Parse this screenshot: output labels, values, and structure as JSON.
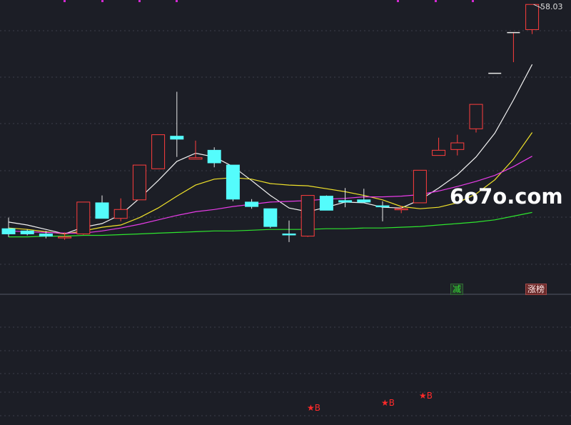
{
  "chart_data": {
    "type": "candlestick",
    "price_range": [
      20.0,
      58.6
    ],
    "max_price_label": "58.03",
    "candles": [
      {
        "o": 27.7,
        "c": 27.0,
        "h": 29.2,
        "l": 26.6
      },
      {
        "o": 27.4,
        "c": 27.0,
        "h": 27.6,
        "l": 26.8
      },
      {
        "o": 27.0,
        "c": 26.7,
        "h": 27.4,
        "l": 26.4
      },
      {
        "o": 26.5,
        "c": 26.6,
        "h": 27.2,
        "l": 26.2
      },
      {
        "o": 27.0,
        "c": 31.3,
        "h": 31.3,
        "l": 26.9
      },
      {
        "o": 31.2,
        "c": 29.1,
        "h": 32.2,
        "l": 29.1
      },
      {
        "o": 29.1,
        "c": 30.3,
        "h": 31.8,
        "l": 28.7
      },
      {
        "o": 31.6,
        "c": 36.3,
        "h": 36.3,
        "l": 31.6
      },
      {
        "o": 35.8,
        "c": 40.4,
        "h": 40.4,
        "l": 35.8
      },
      {
        "o": 40.2,
        "c": 39.8,
        "h": 46.2,
        "l": 37.4
      },
      {
        "o": 37.1,
        "c": 37.3,
        "h": 39.6,
        "l": 37.1
      },
      {
        "o": 38.3,
        "c": 36.6,
        "h": 38.7,
        "l": 36.0
      },
      {
        "o": 36.3,
        "c": 31.7,
        "h": 36.3,
        "l": 31.4
      },
      {
        "o": 31.3,
        "c": 30.7,
        "h": 31.7,
        "l": 30.4
      },
      {
        "o": 30.4,
        "c": 28.0,
        "h": 30.4,
        "l": 27.8
      },
      {
        "o": 27.0,
        "c": 26.9,
        "h": 28.8,
        "l": 25.9
      },
      {
        "o": 26.7,
        "c": 32.2,
        "h": 32.2,
        "l": 26.6
      },
      {
        "o": 32.1,
        "c": 30.2,
        "h": 32.2,
        "l": 30.2
      },
      {
        "o": 31.5,
        "c": 31.3,
        "h": 33.2,
        "l": 30.6
      },
      {
        "o": 31.6,
        "c": 31.3,
        "h": 33.1,
        "l": 31.2
      },
      {
        "o": 30.8,
        "c": 30.7,
        "h": 31.4,
        "l": 28.7
      },
      {
        "o": 30.3,
        "c": 30.4,
        "h": 30.8,
        "l": 29.8
      },
      {
        "o": 31.2,
        "c": 35.6,
        "h": 35.6,
        "l": 31.2
      },
      {
        "o": 37.6,
        "c": 38.3,
        "h": 40.0,
        "l": 37.6
      },
      {
        "o": 38.4,
        "c": 39.3,
        "h": 40.4,
        "l": 37.6
      },
      {
        "o": 41.2,
        "c": 44.5,
        "h": 44.5,
        "l": 40.7
      },
      {
        "o": 48.7,
        "c": 48.7,
        "h": 48.7,
        "l": 48.7
      },
      {
        "o": 54.2,
        "c": 54.2,
        "h": 54.2,
        "l": 50.2
      },
      {
        "o": 54.6,
        "c": 58.0,
        "h": 58.0,
        "l": 54.0
      }
    ],
    "moving_averages": [
      {
        "color": "#f2f2f2",
        "values": [
          28.6,
          28.2,
          27.6,
          27.0,
          27.9,
          28.4,
          29.6,
          31.8,
          34.2,
          36.8,
          37.9,
          37.4,
          36.1,
          34.2,
          32.2,
          30.5,
          30.0,
          30.6,
          31.3,
          31.2,
          30.6,
          30.5,
          31.6,
          33.2,
          35.0,
          37.4,
          40.6,
          45.1,
          49.9
        ]
      },
      {
        "color": "#f0e22a",
        "values": [
          27.8,
          27.6,
          27.3,
          27.0,
          27.4,
          27.9,
          28.2,
          29.2,
          30.5,
          32.1,
          33.6,
          34.4,
          34.6,
          34.4,
          33.8,
          33.6,
          33.5,
          33.1,
          32.7,
          32.2,
          31.6,
          30.7,
          30.4,
          30.6,
          31.2,
          32.4,
          34.3,
          37.1,
          40.7
        ]
      },
      {
        "color": "#e83ce8",
        "values": [
          27.4,
          27.3,
          27.2,
          27.1,
          27.1,
          27.4,
          27.8,
          28.3,
          28.9,
          29.5,
          30.0,
          30.3,
          30.7,
          31.0,
          31.3,
          31.4,
          31.5,
          31.7,
          31.8,
          32.0,
          32.0,
          32.1,
          32.3,
          32.8,
          33.4,
          34.1,
          34.9,
          36.1,
          37.5
        ]
      },
      {
        "color": "#2ee62e",
        "values": [
          26.6,
          26.6,
          26.7,
          26.7,
          26.8,
          26.8,
          26.9,
          27.0,
          27.1,
          27.2,
          27.3,
          27.4,
          27.4,
          27.5,
          27.6,
          27.6,
          27.6,
          27.7,
          27.7,
          27.8,
          27.8,
          27.9,
          28.0,
          28.2,
          28.4,
          28.6,
          28.9,
          29.4,
          29.9
        ]
      }
    ],
    "tags": [
      {
        "text": "减",
        "candle": 24
      },
      {
        "text": "涨榜",
        "candle": 28
      }
    ],
    "buy_signals": [
      {
        "text": "★B",
        "candle": 16
      },
      {
        "text": "★B",
        "candle": 20
      },
      {
        "text": "★B",
        "candle": 22
      }
    ]
  },
  "watermark": "6o7o.com",
  "colors": {
    "up": "#ff3d3d",
    "down": "#54fcfc",
    "grid": "#3c3f4a",
    "background": "#1c1e26"
  }
}
